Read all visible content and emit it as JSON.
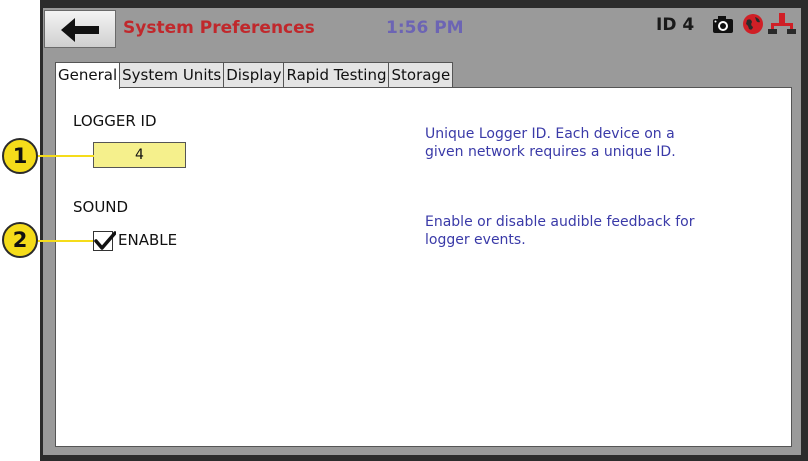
{
  "header": {
    "back_icon": "left-arrow-icon",
    "title": "System Preferences",
    "time": "1:56 PM",
    "device_id": "ID 4",
    "status_icons": [
      "camera-icon",
      "globe-icon",
      "network-icon"
    ]
  },
  "tabs": [
    {
      "label": "General",
      "active": true
    },
    {
      "label": "System Units",
      "active": false
    },
    {
      "label": "Display",
      "active": false
    },
    {
      "label": "Rapid Testing",
      "active": false
    },
    {
      "label": "Storage",
      "active": false
    }
  ],
  "general": {
    "logger_id_label": "LOGGER ID",
    "logger_id_value": "4",
    "logger_id_hint": [
      "Unique Logger ID.  Each device on a",
      "given network requires a unique ID."
    ],
    "sound_label": "SOUND",
    "sound_enable_label": "ENABLE",
    "sound_enabled": true,
    "sound_hint": [
      "Enable or disable audible feedback for",
      "logger events."
    ]
  },
  "callouts": [
    "1",
    "2"
  ],
  "colors": {
    "title": "#c0282c",
    "clock": "#6c64b4",
    "hint_text": "#3a3aa8",
    "id_field": "#f5f08c",
    "callout": "#f5dc1a"
  }
}
